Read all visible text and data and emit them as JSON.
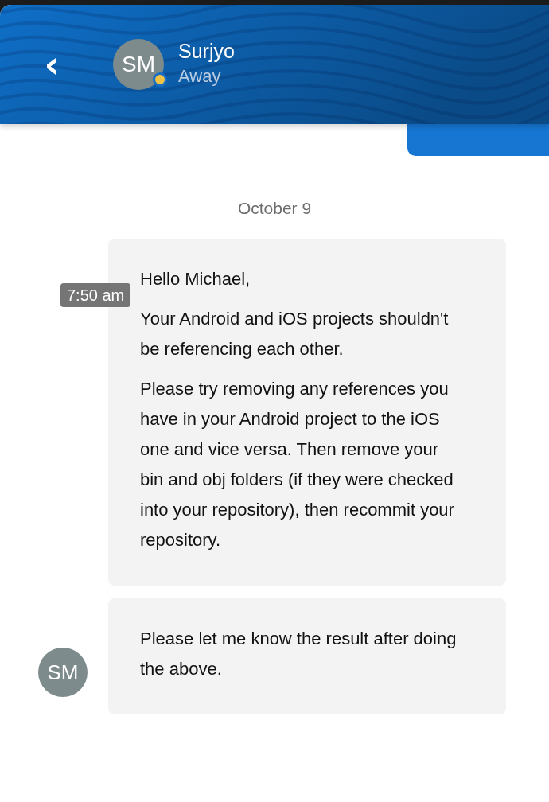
{
  "header": {
    "back_icon": "‹",
    "contact": {
      "initials": "SM",
      "name": "Surjyo",
      "status": "Away",
      "color": "#f2c445"
    }
  },
  "date_divider": "October 9",
  "messages": [
    {
      "timestamp": "7:50 am",
      "paragraphs": [
        "Hello Michael,",
        "Your Android and iOS projects shouldn't be referencing each other.",
        "Please try removing any references you have in your Android project to the iOS one and vice versa. Then remove your bin and obj folders (if they were checked into your repository), then recommit your repository."
      ]
    },
    {
      "avatar_initials": "SM",
      "paragraphs": [
        "Please let me know the result after doing the above."
      ]
    }
  ]
}
